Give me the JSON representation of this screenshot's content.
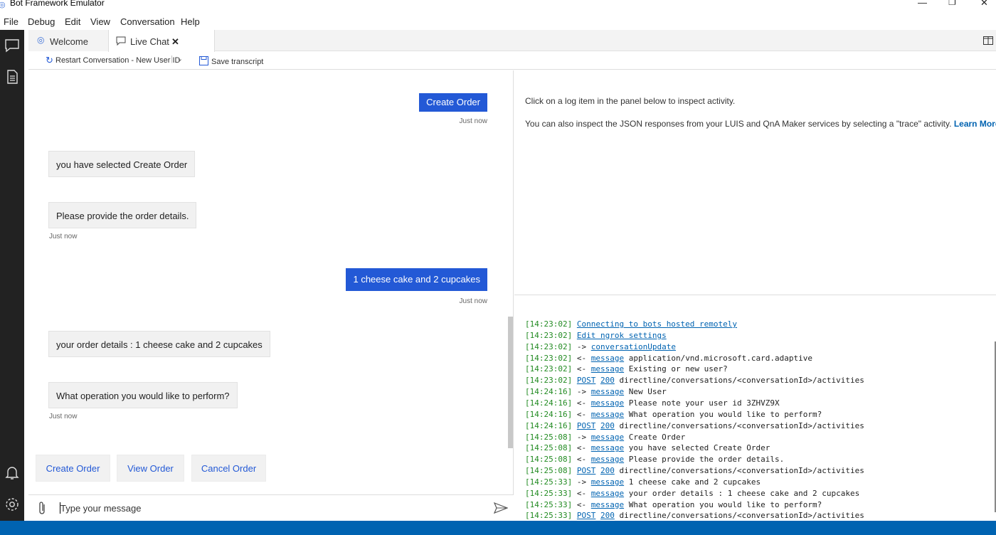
{
  "app_title": "Bot Framework Emulator",
  "menu": [
    "File",
    "Debug",
    "Edit",
    "View",
    "Conversation",
    "Help"
  ],
  "tabs": {
    "welcome": "Welcome",
    "live": "Live Chat",
    "close_glyph": "✕"
  },
  "toolbar": {
    "restart": "Restart Conversation - New User ID",
    "save": "Save transcript"
  },
  "messages": [
    {
      "from": "user",
      "text": "Create Order",
      "time": "Just now"
    },
    {
      "from": "bot",
      "text": "you have selected Create Order",
      "time": ""
    },
    {
      "from": "bot",
      "text": "Please provide the order details.",
      "time": "Just now"
    },
    {
      "from": "user",
      "text": "1 cheese cake and 2 cupcakes",
      "time": "Just now"
    },
    {
      "from": "bot",
      "text": "your order details : 1 cheese cake and 2 cupcakes",
      "time": ""
    },
    {
      "from": "bot",
      "text": "What operation you would like to perform?",
      "time": "Just now"
    }
  ],
  "suggested_actions": [
    "Create Order",
    "View Order",
    "Cancel Order"
  ],
  "compose": {
    "placeholder": "Type your message"
  },
  "inspector": {
    "line1": "Click on a log item in the panel below to inspect activity.",
    "line2": "You can also inspect the JSON responses from your LUIS and QnA Maker services by selecting a \"trace\" activity.",
    "learn_more": "Learn More."
  },
  "log": [
    {
      "time": "[14:23:02]",
      "arrow": "",
      "link": "Connecting to bots hosted remotely",
      "text": ""
    },
    {
      "time": "[14:23:02]",
      "arrow": "",
      "link": "Edit ngrok settings",
      "text": ""
    },
    {
      "time": "[14:23:02]",
      "arrow": "->",
      "link": "conversationUpdate",
      "text": ""
    },
    {
      "time": "[14:23:02]",
      "arrow": "<-",
      "link": "message",
      "text": "application/vnd.microsoft.card.adaptive"
    },
    {
      "time": "[14:23:02]",
      "arrow": "<-",
      "link": "message",
      "text": "Existing or new user?"
    },
    {
      "time": "[14:23:02]",
      "arrow": "",
      "link": "POST",
      "link2": "200",
      "text": "directline/conversations/<conversationId>/activities"
    },
    {
      "time": "[14:24:16]",
      "arrow": "->",
      "link": "message",
      "text": "New User"
    },
    {
      "time": "[14:24:16]",
      "arrow": "<-",
      "link": "message",
      "text": "Please note your user id 3ZHVZ9X"
    },
    {
      "time": "[14:24:16]",
      "arrow": "<-",
      "link": "message",
      "text": "What operation you would like to perform?"
    },
    {
      "time": "[14:24:16]",
      "arrow": "",
      "link": "POST",
      "link2": "200",
      "text": "directline/conversations/<conversationId>/activities"
    },
    {
      "time": "[14:25:08]",
      "arrow": "->",
      "link": "message",
      "text": "Create Order"
    },
    {
      "time": "[14:25:08]",
      "arrow": "<-",
      "link": "message",
      "text": "you have selected Create Order"
    },
    {
      "time": "[14:25:08]",
      "arrow": "<-",
      "link": "message",
      "text": "Please provide the order details."
    },
    {
      "time": "[14:25:08]",
      "arrow": "",
      "link": "POST",
      "link2": "200",
      "text": "directline/conversations/<conversationId>/activities"
    },
    {
      "time": "[14:25:33]",
      "arrow": "->",
      "link": "message",
      "text": "1 cheese cake and 2 cupcakes"
    },
    {
      "time": "[14:25:33]",
      "arrow": "<-",
      "link": "message",
      "text": "your order details : 1 cheese cake and 2 cupcakes"
    },
    {
      "time": "[14:25:33]",
      "arrow": "<-",
      "link": "message",
      "text": "What operation you would like to perform?"
    },
    {
      "time": "[14:25:33]",
      "arrow": "",
      "link": "POST",
      "link2": "200",
      "text": "directline/conversations/<conversationId>/activities"
    }
  ],
  "colors": {
    "accent": "#2359d6",
    "link": "#0063b1",
    "status_bar": "#0063b1",
    "log_time": "#228b22"
  }
}
